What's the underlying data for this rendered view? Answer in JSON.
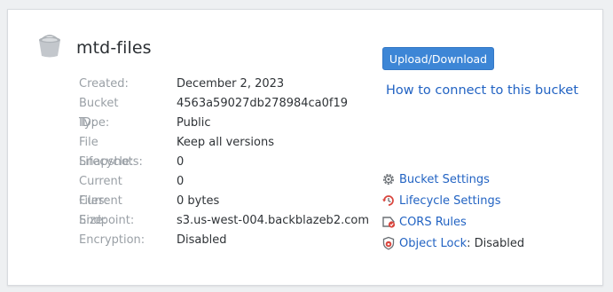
{
  "bucket": {
    "name": "mtd-files",
    "icon": "bucket-icon"
  },
  "details": [
    {
      "label": "Created:",
      "value": "December 2, 2023"
    },
    {
      "label": "Bucket ID:",
      "value": "4563a59027db278984ca0f19"
    },
    {
      "label": "Type:",
      "value": "Public"
    },
    {
      "label": "File Lifecycle:",
      "value": "Keep all versions"
    },
    {
      "label": "Snapshots:",
      "value": "0"
    },
    {
      "label": "Current Files:",
      "value": "0"
    },
    {
      "label": "Current Size:",
      "value": "0 bytes"
    },
    {
      "label": "Endpoint:",
      "value": "s3.us-west-004.backblazeb2.com"
    },
    {
      "label": "Encryption:",
      "value": "Disabled"
    }
  ],
  "actions": {
    "upload_label": "Upload/Download",
    "connect_label": "How to connect to this bucket"
  },
  "side_links": {
    "bucket_settings": {
      "label": "Bucket Settings",
      "icon": "gear-icon"
    },
    "lifecycle_settings": {
      "label": "Lifecycle Settings",
      "icon": "lifecycle-icon"
    },
    "cors_rules": {
      "label": "CORS Rules",
      "icon": "cors-icon"
    },
    "object_lock": {
      "label": "Object Lock",
      "suffix": ": Disabled",
      "icon": "shield-lock-icon"
    }
  },
  "colors": {
    "link": "#2263c3",
    "button": "#3d86d6",
    "label": "#9aa0a6",
    "icon_red": "#d9453d"
  }
}
